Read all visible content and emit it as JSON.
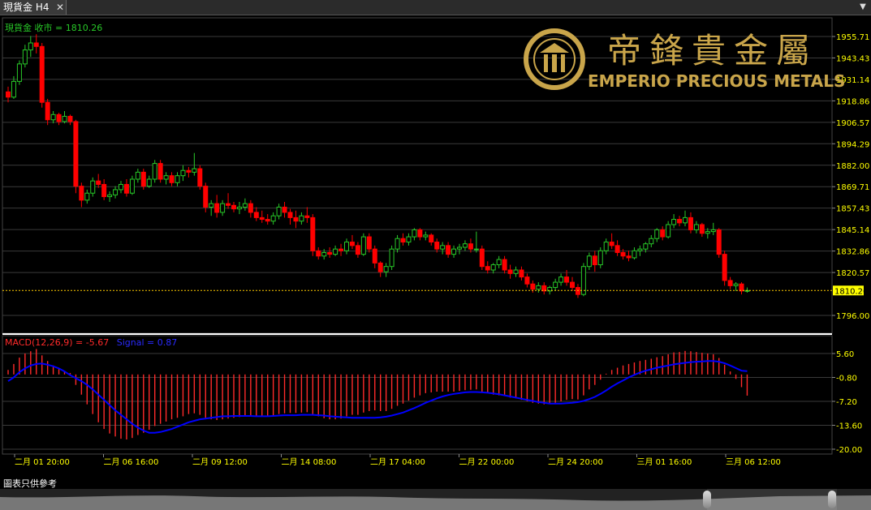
{
  "window": {
    "tab_title": "現貨金 H4",
    "close_glyph": "✕",
    "menu_glyph": "▼"
  },
  "price_panel": {
    "label": "現貨金 收市 = 1810.26",
    "last_price_label": "1810.26"
  },
  "macd_panel": {
    "label_macd": "MACD(12,26,9) = -5.67",
    "label_signal": "Signal = 0.87"
  },
  "logo": {
    "chinese": "帝鋒貴金屬",
    "english": "EMPERIO PRECIOUS METALS"
  },
  "footer": {
    "note": "圖表只供參考"
  },
  "colors": {
    "up": "#28c828",
    "down": "#ff0000",
    "signal": "#0000ff",
    "histogram": "#ff2a2a",
    "axis_text": "#ffff00",
    "label_green": "#28c828",
    "last_price_line": "#ffcc00",
    "gold": "#c9a54a"
  },
  "chart_data": [
    {
      "type": "candlestick",
      "title": "現貨金 H4",
      "y_ticks": [
        "1955.71",
        "1943.43",
        "1931.14",
        "1918.86",
        "1906.57",
        "1894.29",
        "1882.00",
        "1869.71",
        "1857.43",
        "1845.14",
        "1832.86",
        "1820.57",
        "1796.00"
      ],
      "ylim": [
        1796.0,
        1955.71
      ],
      "x_tick_labels": [
        "二月 01 20:00",
        "二月 06 16:00",
        "二月 09 12:00",
        "二月 14 08:00",
        "二月 17 04:00",
        "二月 22 00:00",
        "二月 24 20:00",
        "三月 01 16:00",
        "三月 06 12:00"
      ],
      "last_close": 1810.26,
      "ohlc": [
        [
          1924.0,
          1927.0,
          1918.0,
          1921.0
        ],
        [
          1921.0,
          1933.0,
          1920.0,
          1930.0
        ],
        [
          1930.0,
          1942.0,
          1928.0,
          1940.0
        ],
        [
          1940.0,
          1951.0,
          1938.0,
          1948.0
        ],
        [
          1948.0,
          1956.0,
          1944.0,
          1952.0
        ],
        [
          1952.0,
          1957.0,
          1946.0,
          1950.0
        ],
        [
          1950.0,
          1952.0,
          1915.0,
          1918.0
        ],
        [
          1918.0,
          1920.0,
          1905.0,
          1908.0
        ],
        [
          1908.0,
          1913.0,
          1906.0,
          1911.0
        ],
        [
          1911.0,
          1912.0,
          1905.0,
          1907.0
        ],
        [
          1907.0,
          1913.0,
          1906.0,
          1910.0
        ],
        [
          1910.0,
          1911.0,
          1905.0,
          1907.0
        ],
        [
          1907.0,
          1908.0,
          1866.0,
          1870.0
        ],
        [
          1870.0,
          1872.0,
          1858.0,
          1862.0
        ],
        [
          1862.0,
          1868.0,
          1860.0,
          1866.0
        ],
        [
          1866.0,
          1875.0,
          1864.0,
          1873.0
        ],
        [
          1873.0,
          1877.0,
          1869.0,
          1871.0
        ],
        [
          1871.0,
          1874.0,
          1862.0,
          1864.0
        ],
        [
          1864.0,
          1867.0,
          1861.0,
          1865.0
        ],
        [
          1865.0,
          1870.0,
          1863.0,
          1868.0
        ],
        [
          1868.0,
          1873.0,
          1866.0,
          1871.0
        ],
        [
          1871.0,
          1874.0,
          1864.0,
          1866.0
        ],
        [
          1866.0,
          1876.0,
          1865.0,
          1874.0
        ],
        [
          1874.0,
          1880.0,
          1872.0,
          1878.0
        ],
        [
          1878.0,
          1880.0,
          1868.0,
          1870.0
        ],
        [
          1870.0,
          1876.0,
          1869.0,
          1874.0
        ],
        [
          1874.0,
          1885.0,
          1872.0,
          1883.0
        ],
        [
          1883.0,
          1885.0,
          1872.0,
          1874.0
        ],
        [
          1874.0,
          1878.0,
          1871.0,
          1876.0
        ],
        [
          1876.0,
          1878.0,
          1870.0,
          1872.0
        ],
        [
          1872.0,
          1878.0,
          1870.0,
          1876.0
        ],
        [
          1876.0,
          1882.0,
          1873.0,
          1879.0
        ],
        [
          1879.0,
          1881.0,
          1875.0,
          1878.0
        ],
        [
          1878.0,
          1889.0,
          1876.0,
          1880.0
        ],
        [
          1880.0,
          1882.0,
          1868.0,
          1870.0
        ],
        [
          1870.0,
          1872.0,
          1855.0,
          1858.0
        ],
        [
          1858.0,
          1862.0,
          1853.0,
          1860.0
        ],
        [
          1860.0,
          1865.0,
          1852.0,
          1855.0
        ],
        [
          1855.0,
          1862.0,
          1853.0,
          1860.0
        ],
        [
          1860.0,
          1866.0,
          1857.0,
          1859.0
        ],
        [
          1859.0,
          1861.0,
          1855.0,
          1857.0
        ],
        [
          1857.0,
          1861.0,
          1854.0,
          1858.0
        ],
        [
          1858.0,
          1863.0,
          1856.0,
          1860.0
        ],
        [
          1860.0,
          1862.0,
          1852.0,
          1855.0
        ],
        [
          1855.0,
          1858.0,
          1850.0,
          1852.0
        ],
        [
          1852.0,
          1856.0,
          1849.0,
          1851.0
        ],
        [
          1851.0,
          1854.0,
          1848.0,
          1850.0
        ],
        [
          1850.0,
          1855.0,
          1848.0,
          1853.0
        ],
        [
          1853.0,
          1860.0,
          1851.0,
          1858.0
        ],
        [
          1858.0,
          1861.0,
          1852.0,
          1855.0
        ],
        [
          1855.0,
          1857.0,
          1848.0,
          1852.0
        ],
        [
          1852.0,
          1856.0,
          1846.0,
          1850.0
        ],
        [
          1850.0,
          1855.0,
          1848.0,
          1853.0
        ],
        [
          1853.0,
          1858.0,
          1849.0,
          1852.0
        ],
        [
          1852.0,
          1854.0,
          1830.0,
          1833.0
        ],
        [
          1833.0,
          1835.0,
          1828.0,
          1830.0
        ],
        [
          1830.0,
          1834.0,
          1828.0,
          1832.0
        ],
        [
          1832.0,
          1835.0,
          1829.0,
          1831.0
        ],
        [
          1831.0,
          1836.0,
          1830.0,
          1834.0
        ],
        [
          1834.0,
          1837.0,
          1830.0,
          1833.0
        ],
        [
          1833.0,
          1840.0,
          1831.0,
          1838.0
        ],
        [
          1838.0,
          1842.0,
          1834.0,
          1836.0
        ],
        [
          1836.0,
          1838.0,
          1829.0,
          1831.0
        ],
        [
          1831.0,
          1843.0,
          1830.0,
          1841.0
        ],
        [
          1841.0,
          1843.0,
          1832.0,
          1834.0
        ],
        [
          1834.0,
          1836.0,
          1823.0,
          1826.0
        ],
        [
          1826.0,
          1827.0,
          1818.0,
          1821.0
        ],
        [
          1821.0,
          1826.0,
          1818.0,
          1824.0
        ],
        [
          1824.0,
          1836.0,
          1822.0,
          1834.0
        ],
        [
          1834.0,
          1842.0,
          1832.0,
          1840.0
        ],
        [
          1840.0,
          1843.0,
          1836.0,
          1838.0
        ],
        [
          1838.0,
          1843.0,
          1836.0,
          1841.0
        ],
        [
          1841.0,
          1846.0,
          1839.0,
          1845.0
        ],
        [
          1845.0,
          1846.0,
          1839.0,
          1841.0
        ],
        [
          1841.0,
          1844.0,
          1839.0,
          1842.0
        ],
        [
          1842.0,
          1843.0,
          1836.0,
          1838.0
        ],
        [
          1838.0,
          1840.0,
          1832.0,
          1834.0
        ],
        [
          1834.0,
          1838.0,
          1831.0,
          1836.0
        ],
        [
          1836.0,
          1838.0,
          1829.0,
          1831.0
        ],
        [
          1831.0,
          1836.0,
          1829.0,
          1834.0
        ],
        [
          1834.0,
          1837.0,
          1831.0,
          1835.0
        ],
        [
          1835.0,
          1839.0,
          1833.0,
          1837.0
        ],
        [
          1837.0,
          1840.0,
          1832.0,
          1834.0
        ],
        [
          1834.0,
          1844.0,
          1832.0,
          1834.0
        ],
        [
          1834.0,
          1836.0,
          1822.0,
          1824.0
        ],
        [
          1824.0,
          1827.0,
          1820.0,
          1822.0
        ],
        [
          1822.0,
          1826.0,
          1820.0,
          1825.0
        ],
        [
          1825.0,
          1830.0,
          1823.0,
          1828.0
        ],
        [
          1828.0,
          1830.0,
          1820.0,
          1822.0
        ],
        [
          1822.0,
          1825.0,
          1817.0,
          1820.0
        ],
        [
          1820.0,
          1824.0,
          1818.0,
          1822.0
        ],
        [
          1822.0,
          1824.0,
          1816.0,
          1818.0
        ],
        [
          1818.0,
          1820.0,
          1812.0,
          1814.0
        ],
        [
          1814.0,
          1816.0,
          1809.0,
          1811.0
        ],
        [
          1811.0,
          1815.0,
          1809.0,
          1813.0
        ],
        [
          1813.0,
          1815.0,
          1808.0,
          1810.0
        ],
        [
          1810.0,
          1813.0,
          1808.0,
          1812.0
        ],
        [
          1812.0,
          1817.0,
          1810.0,
          1815.0
        ],
        [
          1815.0,
          1820.0,
          1813.0,
          1818.0
        ],
        [
          1818.0,
          1822.0,
          1813.0,
          1815.0
        ],
        [
          1815.0,
          1818.0,
          1810.0,
          1812.0
        ],
        [
          1812.0,
          1814.0,
          1806.0,
          1808.0
        ],
        [
          1808.0,
          1826.0,
          1807.0,
          1824.0
        ],
        [
          1824.0,
          1832.0,
          1822.0,
          1830.0
        ],
        [
          1830.0,
          1833.0,
          1821.0,
          1825.0
        ],
        [
          1825.0,
          1835.0,
          1823.0,
          1833.0
        ],
        [
          1833.0,
          1840.0,
          1831.0,
          1838.0
        ],
        [
          1838.0,
          1843.0,
          1834.0,
          1836.0
        ],
        [
          1836.0,
          1839.0,
          1830.0,
          1832.0
        ],
        [
          1832.0,
          1834.0,
          1828.0,
          1830.0
        ],
        [
          1830.0,
          1833.0,
          1827.0,
          1829.0
        ],
        [
          1829.0,
          1835.0,
          1828.0,
          1833.0
        ],
        [
          1833.0,
          1836.0,
          1830.0,
          1834.0
        ],
        [
          1834.0,
          1838.0,
          1832.0,
          1837.0
        ],
        [
          1837.0,
          1842.0,
          1835.0,
          1840.0
        ],
        [
          1840.0,
          1846.0,
          1838.0,
          1845.0
        ],
        [
          1845.0,
          1847.0,
          1839.0,
          1841.0
        ],
        [
          1841.0,
          1850.0,
          1840.0,
          1848.0
        ],
        [
          1848.0,
          1854.0,
          1846.0,
          1851.0
        ],
        [
          1851.0,
          1853.0,
          1847.0,
          1849.0
        ],
        [
          1849.0,
          1856.0,
          1847.0,
          1852.0
        ],
        [
          1852.0,
          1855.0,
          1843.0,
          1845.0
        ],
        [
          1845.0,
          1850.0,
          1843.0,
          1848.0
        ],
        [
          1848.0,
          1849.0,
          1841.0,
          1843.0
        ],
        [
          1843.0,
          1846.0,
          1840.0,
          1844.0
        ],
        [
          1844.0,
          1849.0,
          1842.0,
          1845.0
        ],
        [
          1845.0,
          1846.0,
          1829.0,
          1831.0
        ],
        [
          1831.0,
          1833.0,
          1813.0,
          1816.0
        ],
        [
          1816.0,
          1818.0,
          1811.0,
          1813.0
        ],
        [
          1813.0,
          1815.0,
          1810.0,
          1814.0
        ],
        [
          1814.0,
          1815.0,
          1808.0,
          1810.0
        ],
        [
          1810.0,
          1812.0,
          1809.0,
          1810.26
        ]
      ]
    },
    {
      "type": "bar+line",
      "title": "MACD(12,26,9)",
      "y_ticks": [
        "5.60",
        "-0.80",
        "-7.20",
        "-13.60",
        "-20.00"
      ],
      "ylim": [
        -20.0,
        5.6
      ],
      "macd_value": -5.67,
      "signal_value": 0.87,
      "macd_histogram": [
        1.2,
        2.8,
        4.5,
        5.6,
        6.2,
        6.8,
        5.1,
        3.6,
        2.4,
        1.6,
        1.0,
        0.4,
        -2.8,
        -5.4,
        -8.0,
        -10.6,
        -12.8,
        -14.6,
        -15.8,
        -16.6,
        -17.2,
        -17.4,
        -17.0,
        -16.2,
        -15.6,
        -14.8,
        -13.8,
        -13.2,
        -12.6,
        -12.0,
        -11.6,
        -11.2,
        -10.6,
        -10.4,
        -10.8,
        -11.6,
        -12.0,
        -12.2,
        -12.0,
        -11.8,
        -11.6,
        -11.4,
        -11.2,
        -11.2,
        -11.2,
        -11.2,
        -11.1,
        -11.0,
        -10.6,
        -10.4,
        -10.3,
        -10.3,
        -10.2,
        -10.1,
        -10.6,
        -11.2,
        -11.7,
        -12.0,
        -12.0,
        -11.8,
        -11.2,
        -10.8,
        -10.8,
        -10.2,
        -9.8,
        -9.6,
        -9.8,
        -9.8,
        -9.2,
        -8.4,
        -7.8,
        -7.0,
        -6.2,
        -5.6,
        -5.0,
        -4.8,
        -4.6,
        -4.6,
        -4.6,
        -4.6,
        -4.4,
        -4.2,
        -4.1,
        -4.0,
        -4.6,
        -5.0,
        -5.4,
        -5.6,
        -5.8,
        -6.2,
        -6.4,
        -6.8,
        -7.2,
        -7.6,
        -7.8,
        -8.0,
        -7.9,
        -7.6,
        -7.2,
        -6.8,
        -6.6,
        -6.7,
        -5.6,
        -4.0,
        -2.8,
        -1.4,
        0.2,
        1.2,
        1.8,
        2.4,
        2.8,
        3.2,
        3.6,
        3.9,
        4.2,
        4.6,
        4.9,
        5.4,
        5.9,
        6.0,
        6.3,
        6.2,
        6.0,
        5.8,
        5.6,
        5.4,
        4.4,
        2.6,
        0.8,
        -1.2,
        -3.4,
        -5.67
      ],
      "signal_line": [
        -1.8,
        -0.8,
        0.6,
        1.6,
        2.4,
        2.8,
        2.9,
        2.6,
        2.2,
        1.6,
        0.8,
        -0.2,
        -1.0,
        -1.8,
        -2.8,
        -4.0,
        -5.4,
        -6.8,
        -8.2,
        -9.6,
        -10.8,
        -12.0,
        -13.2,
        -14.2,
        -15.0,
        -15.6,
        -15.6,
        -15.4,
        -15.0,
        -14.6,
        -14.0,
        -13.4,
        -12.8,
        -12.4,
        -12.0,
        -11.8,
        -11.6,
        -11.4,
        -11.2,
        -11.2,
        -11.1,
        -11.1,
        -11.1,
        -11.1,
        -11.2,
        -11.2,
        -11.2,
        -11.1,
        -11.0,
        -10.9,
        -10.9,
        -10.9,
        -10.8,
        -10.8,
        -10.8,
        -10.9,
        -11.0,
        -11.2,
        -11.3,
        -11.4,
        -11.5,
        -11.6,
        -11.6,
        -11.6,
        -11.6,
        -11.6,
        -11.5,
        -11.3,
        -11.0,
        -10.6,
        -10.2,
        -9.6,
        -9.0,
        -8.3,
        -7.6,
        -7.0,
        -6.4,
        -5.9,
        -5.5,
        -5.2,
        -5.0,
        -4.8,
        -4.7,
        -4.7,
        -4.8,
        -4.9,
        -5.1,
        -5.3,
        -5.6,
        -5.9,
        -6.2,
        -6.5,
        -6.8,
        -7.1,
        -7.4,
        -7.6,
        -7.8,
        -7.8,
        -7.8,
        -7.7,
        -7.6,
        -7.4,
        -7.1,
        -6.6,
        -6.0,
        -5.2,
        -4.3,
        -3.3,
        -2.4,
        -1.6,
        -0.8,
        -0.1,
        0.5,
        1.0,
        1.4,
        1.8,
        2.1,
        2.4,
        2.7,
        2.9,
        3.1,
        3.3,
        3.4,
        3.5,
        3.6,
        3.6,
        3.4,
        3.0,
        2.4,
        1.7,
        1.0,
        0.87
      ]
    }
  ]
}
